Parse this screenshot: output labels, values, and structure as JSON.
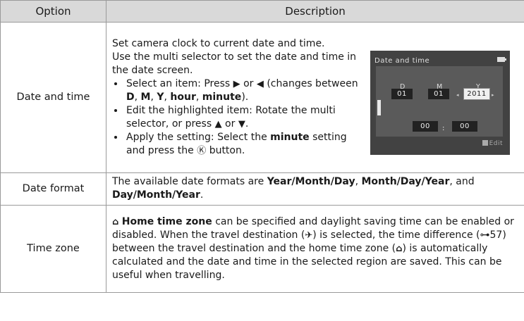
{
  "table": {
    "header": {
      "option": "Option",
      "description": "Description"
    },
    "rows": [
      {
        "option": "Date and time",
        "desc": {
          "p1": "Set camera clock to current date and time.",
          "p2": "Use the multi selector to set the date and time in the date screen.",
          "b1": {
            "t1": "Select an item: Press",
            "arrow_right": "▶",
            "or": "or",
            "arrow_left": "◀",
            "t2": "(changes between",
            "d": "D",
            "m": "M",
            "y": "Y",
            "hour": "hour",
            "minute": "minute",
            "end": ")."
          },
          "b2": {
            "t1": "Edit the highlighted item: Rotate the multi selector, or press",
            "arrow_up": "▲",
            "or": "or",
            "arrow_down": "▼",
            "end": "."
          },
          "b3": {
            "t1": "Apply the setting: Select the",
            "minute": "minute",
            "t2": "setting and press the",
            "ok": "Ⓚ",
            "t3": "button."
          }
        },
        "camera_screen": {
          "title": "Date and time",
          "labels": {
            "d": "D",
            "m": "M",
            "y": "Y"
          },
          "values": {
            "d": "01",
            "m": "01",
            "y": "2011",
            "hour": "00",
            "minute": "00"
          },
          "colon": ":",
          "edit": "Edit",
          "arrow_left": "◂",
          "arrow_right": "▸"
        }
      },
      {
        "option": "Date format",
        "desc": {
          "t1": "The available date formats are",
          "f1": "Year/Month/Day",
          "f2": "Month/Day/Year",
          "and": ", and",
          "f3": "Day/Month/Year",
          "end": "."
        }
      },
      {
        "option": "Time zone",
        "desc": {
          "home_icon": "⌂",
          "home": "Home time zone",
          "t1": "can be specified and daylight saving time can be enabled or disabled. When the travel destination (",
          "plane": "✈",
          "t2": ") is selected, the time difference (",
          "ref": "⊶57",
          "t3": ") between the travel destination and the home time zone (",
          "home_icon2": "⌂",
          "t4": ") is automatically calculated and the date and time in the selected region are saved. This can be useful when travelling."
        }
      }
    ]
  }
}
